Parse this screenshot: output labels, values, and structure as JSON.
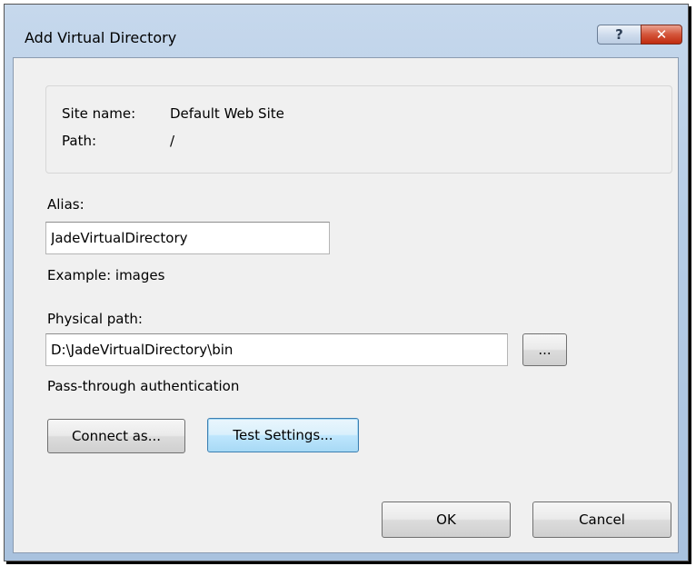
{
  "window": {
    "title": "Add Virtual Directory",
    "help_icon_glyph": "?",
    "close_icon_glyph": "✕"
  },
  "site_info": {
    "site_name_label": "Site name:",
    "site_name_value": "Default Web Site",
    "path_label": "Path:",
    "path_value": "/"
  },
  "alias": {
    "label": "Alias:",
    "value": "JadeVirtualDirectory",
    "example": "Example: images"
  },
  "physical_path": {
    "label": "Physical path:",
    "value": "D:\\JadeVirtualDirectory\\bin",
    "browse_label": "..."
  },
  "authentication": {
    "text": "Pass-through authentication",
    "connect_as_label": "Connect as...",
    "test_settings_label": "Test Settings..."
  },
  "footer": {
    "ok_label": "OK",
    "cancel_label": "Cancel"
  }
}
